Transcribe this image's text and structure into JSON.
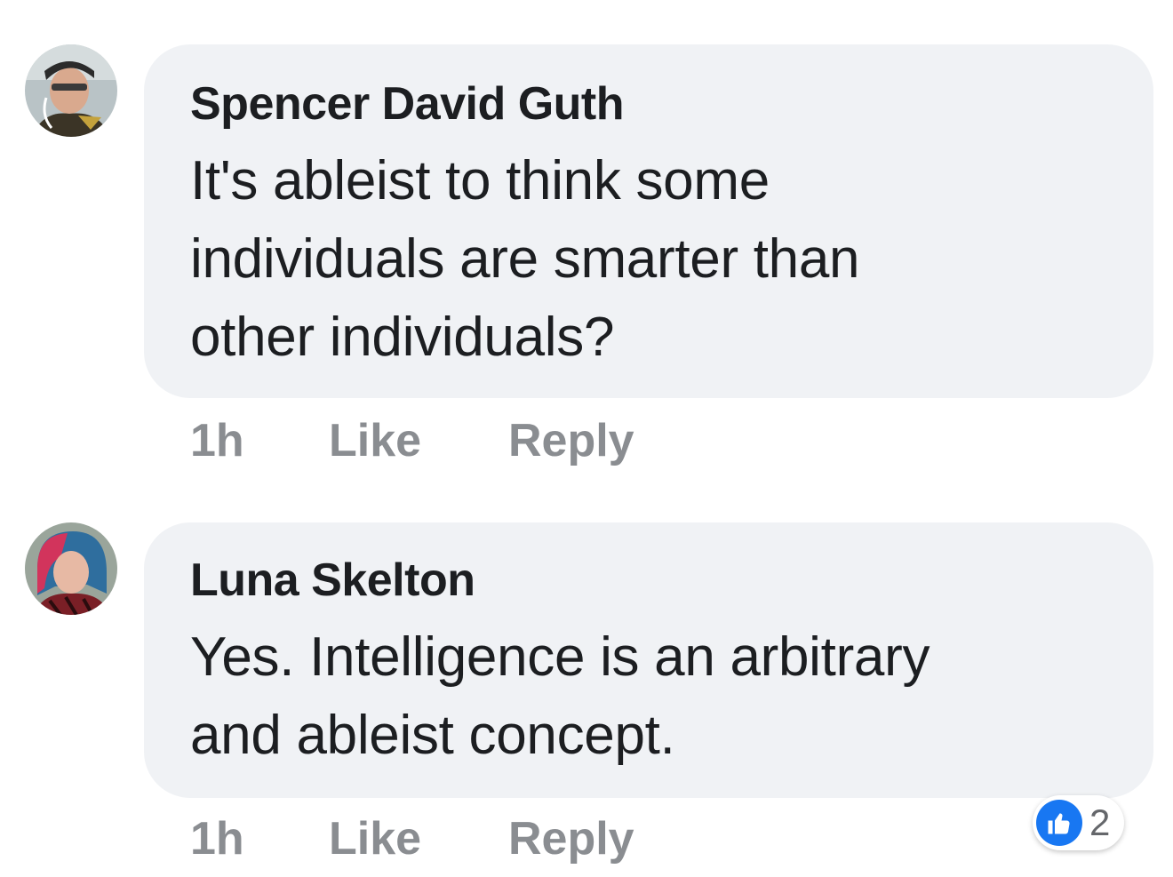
{
  "comments": [
    {
      "author": "Spencer David Guth",
      "lines": [
        "It's ableist to think some",
        "individuals are smarter than",
        "other individuals?"
      ],
      "time": "1h",
      "like_label": "Like",
      "reply_label": "Reply",
      "avatar_icon": "profile-photo-icon"
    },
    {
      "author": "Luna Skelton",
      "lines": [
        "Yes. Intelligence is an arbitrary",
        "and ableist concept."
      ],
      "time": "1h",
      "like_label": "Like",
      "reply_label": "Reply",
      "avatar_icon": "profile-photo-icon",
      "reaction_icon": "thumbs-up-icon",
      "reaction_count": "2"
    }
  ],
  "colors": {
    "bubble": "#f0f2f5",
    "text": "#1c1e21",
    "meta": "#8a8d91",
    "like_blue": "#1877f2"
  }
}
